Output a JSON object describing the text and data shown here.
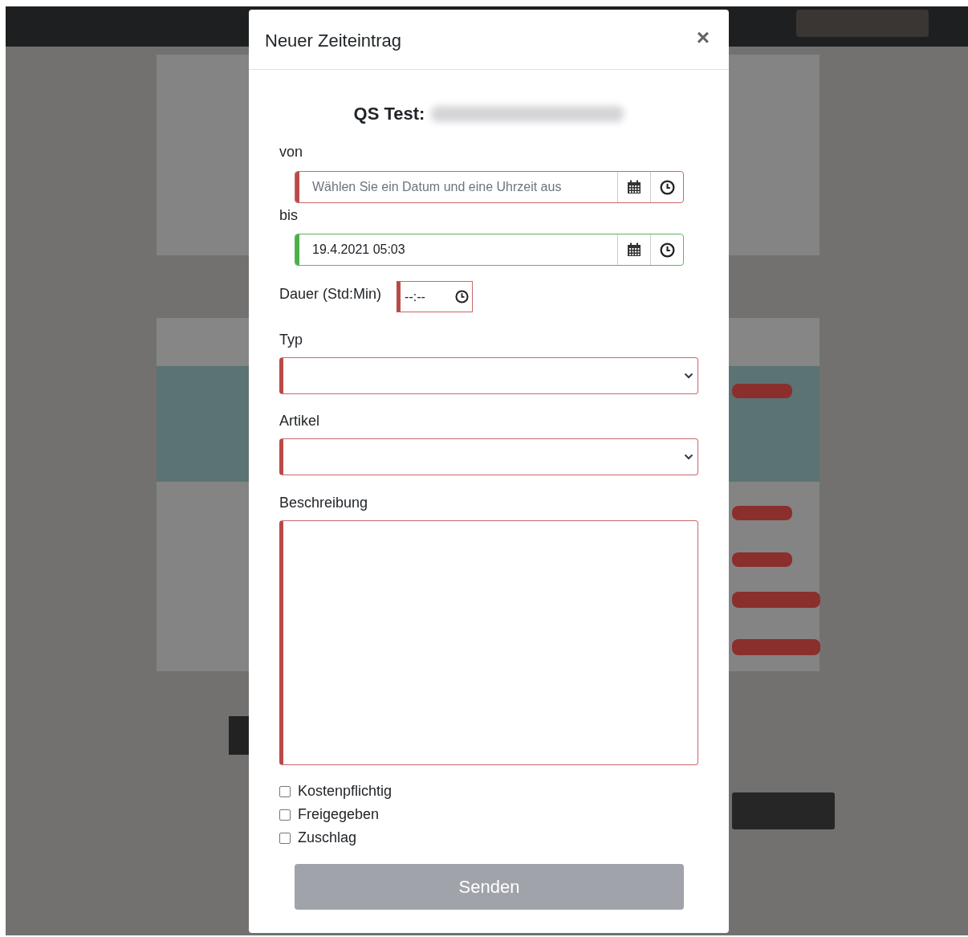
{
  "modal": {
    "title": "Neuer Zeiteintrag",
    "close": "×"
  },
  "heading": {
    "label": "QS Test:",
    "value_redacted": true
  },
  "fields": [
    {
      "kind": "datetime",
      "label": "von",
      "placeholder": "Wählen Sie ein Datum und eine Uhrzeit aus",
      "invalid": true
    },
    {
      "kind": "datetime",
      "label": "bis",
      "value": "19.4.2021 05:03",
      "invalid": false
    },
    {
      "kind": "time",
      "label": "Dauer (Std:Min)",
      "value": "--:--",
      "invalid": true
    },
    {
      "kind": "select",
      "label": "Typ",
      "invalid": true
    },
    {
      "kind": "select",
      "label": "Artikel",
      "invalid": true
    },
    {
      "kind": "textarea",
      "label": "Beschreibung",
      "invalid": true
    }
  ],
  "checkboxes": [
    {
      "label": "Kostenpflichtig",
      "checked": false
    },
    {
      "label": "Freigegeben",
      "checked": false
    },
    {
      "label": "Zuschlag",
      "checked": false
    }
  ],
  "submit": {
    "label": "Senden",
    "disabled": true
  }
}
